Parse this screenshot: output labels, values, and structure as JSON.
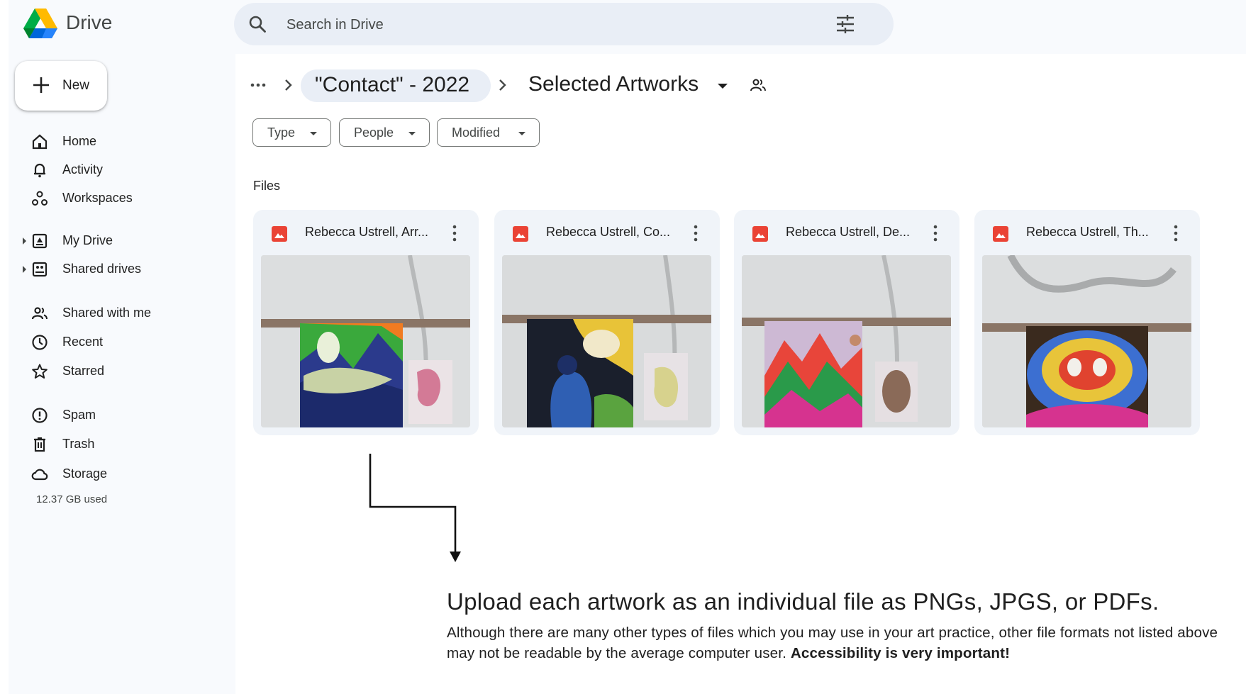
{
  "app": {
    "name": "Drive",
    "brand_colors": [
      "#0066da",
      "#00ac47",
      "#ea4335",
      "#ffba00"
    ]
  },
  "search": {
    "placeholder": "Search in Drive",
    "icon": "search-icon",
    "filter_icon": "tune-icon"
  },
  "sidebar": {
    "new_label": "New",
    "items": [
      {
        "label": "Home",
        "icon": "home-icon"
      },
      {
        "label": "Activity",
        "icon": "bell-icon"
      },
      {
        "label": "Workspaces",
        "icon": "workspaces-icon"
      },
      {
        "label": "My Drive",
        "icon": "my-drive-icon"
      },
      {
        "label": "Shared drives",
        "icon": "shared-drives-icon"
      },
      {
        "label": "Shared with me",
        "icon": "people-icon"
      },
      {
        "label": "Recent",
        "icon": "clock-icon"
      },
      {
        "label": "Starred",
        "icon": "star-icon"
      },
      {
        "label": "Spam",
        "icon": "spam-icon"
      },
      {
        "label": "Trash",
        "icon": "trash-icon"
      },
      {
        "label": "Storage",
        "icon": "cloud-icon"
      }
    ],
    "storage_used": "12.37 GB used"
  },
  "breadcrumb": {
    "parent": "\"Contact\" - 2022",
    "current": "Selected Artworks"
  },
  "filters": {
    "type": "Type",
    "people": "People",
    "modified": "Modified"
  },
  "files": {
    "section_label": "Files",
    "items": [
      {
        "name": "Rebecca Ustrell, Arr..."
      },
      {
        "name": "Rebecca Ustrell, Co..."
      },
      {
        "name": "Rebecca Ustrell, De..."
      },
      {
        "name": "Rebecca Ustrell, Th..."
      }
    ]
  },
  "annotation": {
    "title": "Upload each artwork as an individual file as PNGs, JPGS, or PDFs.",
    "body": "Although there are many other types of files which you may use in your art practice, other file formats not listed above may not be readable by the average computer user.",
    "emphasis": "Accessibility is very important!"
  }
}
